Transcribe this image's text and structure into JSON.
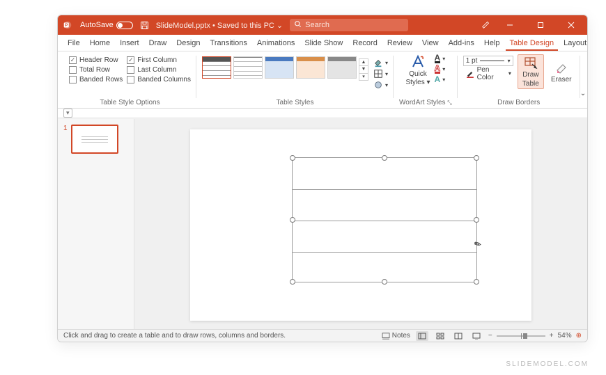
{
  "titlebar": {
    "autosave_label": "AutoSave",
    "autosave_on": false,
    "doc_title": "SlideModel.pptx • Saved to this PC ⌄",
    "search_placeholder": "Search"
  },
  "tabs": [
    "File",
    "Home",
    "Insert",
    "Draw",
    "Design",
    "Transitions",
    "Animations",
    "Slide Show",
    "Record",
    "Review",
    "View",
    "Add-ins",
    "Help",
    "Table Design",
    "Layout"
  ],
  "active_tab": "Table Design",
  "ribbon": {
    "groups": [
      "Table Style Options",
      "Table Styles",
      "WordArt Styles",
      "Draw Borders"
    ],
    "style_options": [
      "Header Row",
      "Total Row",
      "Banded Rows",
      "First Column",
      "Last Column",
      "Banded Columns"
    ],
    "style_options_checked": {
      "Header Row": true,
      "Total Row": false,
      "Banded Rows": false,
      "First Column": true,
      "Last Column": false,
      "Banded Columns": false
    },
    "wordart": {
      "quick1": "Quick",
      "quick2": "Styles ▾"
    },
    "draw_borders": {
      "pen_weight": "1 pt",
      "pen_color_label": "Pen Color ",
      "draw1": "Draw",
      "draw2": "Table",
      "eraser": "Eraser",
      "active_tool": "Draw Table"
    }
  },
  "thumbnails": [
    {
      "num": "1"
    }
  ],
  "status": {
    "message": "Click and drag to create a table and to draw rows, columns and borders.",
    "notes_label": "Notes",
    "zoom": "54%"
  },
  "accent_color": "#d24726",
  "watermark": "SLIDEMODEL.COM"
}
